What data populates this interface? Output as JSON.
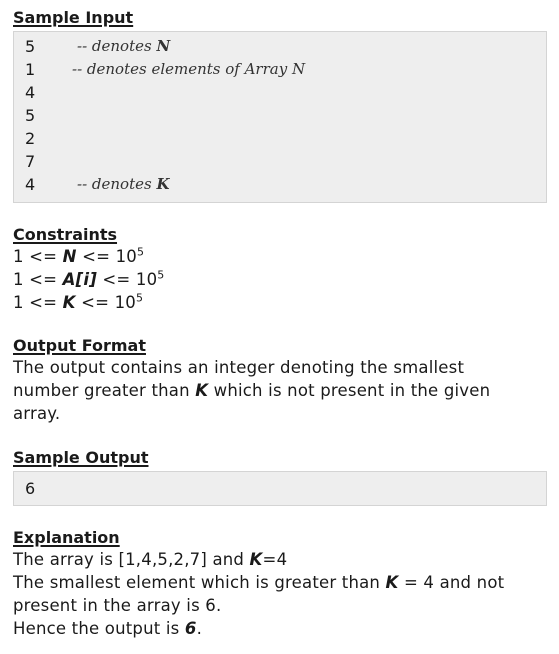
{
  "sample_input": {
    "heading": "Sample Input",
    "rows": [
      {
        "value": "5",
        "comment": "-- denotes ",
        "var": "N",
        "comment_after": ""
      },
      {
        "value": "1",
        "comment": "-- denotes elements of Array N",
        "var": "",
        "comment_after": ""
      },
      {
        "value": "4",
        "comment": "",
        "var": "",
        "comment_after": ""
      },
      {
        "value": "5",
        "comment": "",
        "var": "",
        "comment_after": ""
      },
      {
        "value": "2",
        "comment": "",
        "var": "",
        "comment_after": ""
      },
      {
        "value": "7",
        "comment": "",
        "var": "",
        "comment_after": ""
      },
      {
        "value": "4",
        "comment": "-- denotes ",
        "var": "K",
        "comment_after": ""
      }
    ]
  },
  "constraints": {
    "heading": "Constraints",
    "lines": [
      {
        "prefix": "1 <= ",
        "var": "N",
        "suffix": " <= 10",
        "exp": "5"
      },
      {
        "prefix": "1 <= ",
        "var": "A[i]",
        "suffix": " <= 10",
        "exp": "5"
      },
      {
        "prefix": "1 <= ",
        "var": "K",
        "suffix": " <= 10",
        "exp": "5"
      }
    ]
  },
  "output_format": {
    "heading": "Output Format",
    "text_before": "The output contains an integer denoting the smallest number greater than ",
    "var": "K",
    "text_after": " which is not present in the given array."
  },
  "sample_output": {
    "heading": "Sample Output",
    "value": "6"
  },
  "explanation": {
    "heading": "Explanation",
    "line1_before": "The array is [1,4,5,2,7] and ",
    "line1_var": "K",
    "line1_after": "=4",
    "line2_before": "The smallest element which is greater than ",
    "line2_var": "K",
    "line2_after": " = 4 and not present in the array is 6.",
    "line3_before": "Hence the output is ",
    "line3_var": "6",
    "line3_after": "."
  }
}
